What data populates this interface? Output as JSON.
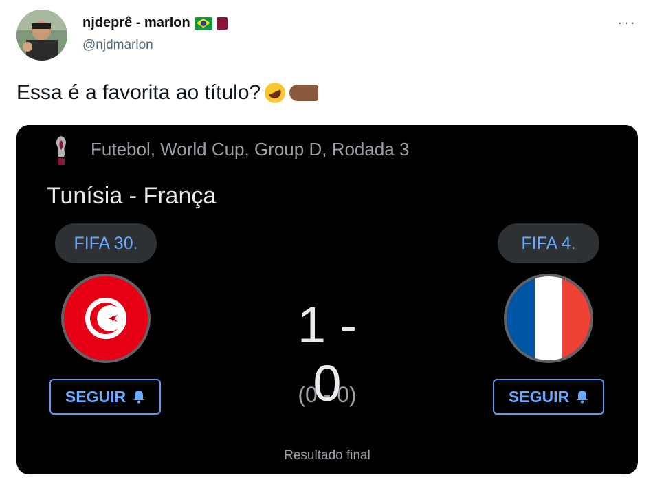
{
  "tweet": {
    "display_name": "njdeprê - marlon",
    "handle": "@njdmarlon",
    "text": "Essa é a favorita ao título?",
    "more_label": "···"
  },
  "card": {
    "competition": "Futebol, World Cup, Group D, Rodada 3",
    "match_title": "Tunísia - França",
    "home": {
      "rank": "FIFA 30.",
      "follow_label": "SEGUIR"
    },
    "away": {
      "rank": "FIFA 4.",
      "follow_label": "SEGUIR"
    },
    "score": "1 - 0",
    "halftime_score": "(0 - 0)",
    "status": "Resultado final"
  },
  "colors": {
    "accent_blue": "#6aa9ff",
    "tunisia_red": "#e70013",
    "france_blue": "#0055a4",
    "france_red": "#ef4135"
  }
}
